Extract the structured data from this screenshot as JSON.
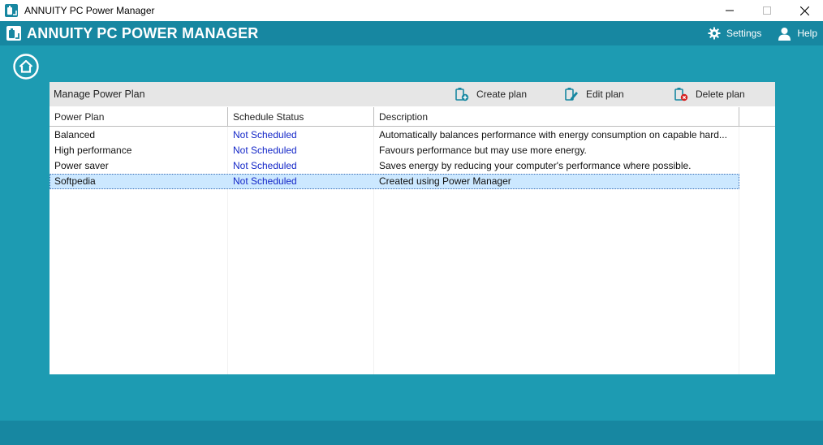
{
  "window": {
    "title": "ANNUITY PC Power Manager",
    "controls": {
      "minimize": "minimize-icon",
      "maximize": "maximize-icon",
      "close": "close-icon"
    }
  },
  "header": {
    "brand": "ANNUITY PC POWER MANAGER",
    "settings_label": "Settings",
    "help_label": "Help"
  },
  "panel": {
    "title": "Manage Power Plan",
    "toolbar": {
      "create_label": "Create plan",
      "edit_label": "Edit plan",
      "delete_label": "Delete plan"
    }
  },
  "table": {
    "columns": [
      "Power Plan",
      "Schedule Status",
      "Description"
    ],
    "rows": [
      {
        "plan": "Balanced",
        "status": "Not Scheduled",
        "description": "Automatically balances performance with energy consumption on capable hard..."
      },
      {
        "plan": "High performance",
        "status": "Not Scheduled",
        "description": "Favours performance but may use more energy."
      },
      {
        "plan": "Power saver",
        "status": "Not Scheduled",
        "description": "Saves energy by reducing your computer's performance where possible."
      },
      {
        "plan": "Softpedia",
        "status": "Not Scheduled",
        "description": "Created using Power Manager"
      }
    ],
    "selected_row": 3
  },
  "colors": {
    "accent": "#1787a1",
    "background": "#1d9bb2",
    "status_text": "#1427c8",
    "selection": "#cce8ff"
  }
}
